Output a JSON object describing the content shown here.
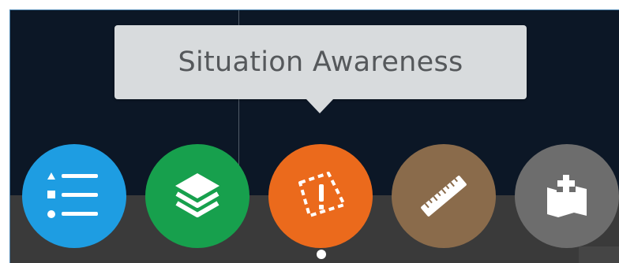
{
  "tooltip": {
    "text": "Situation Awareness"
  },
  "toolbar": {
    "items": [
      {
        "name": "Legend",
        "icon": "list-icon",
        "color": "#1e9de2"
      },
      {
        "name": "Layers",
        "icon": "layers-icon",
        "color": "#17a04d"
      },
      {
        "name": "Situation Awareness",
        "icon": "warning-area-icon",
        "color": "#eb6a1c",
        "active": true
      },
      {
        "name": "Measurement",
        "icon": "ruler-icon",
        "color": "#8a6b4b"
      },
      {
        "name": "Add Data",
        "icon": "add-map-icon",
        "color": "#6d6d6d"
      }
    ]
  },
  "pagination": {
    "current_page": 1
  }
}
